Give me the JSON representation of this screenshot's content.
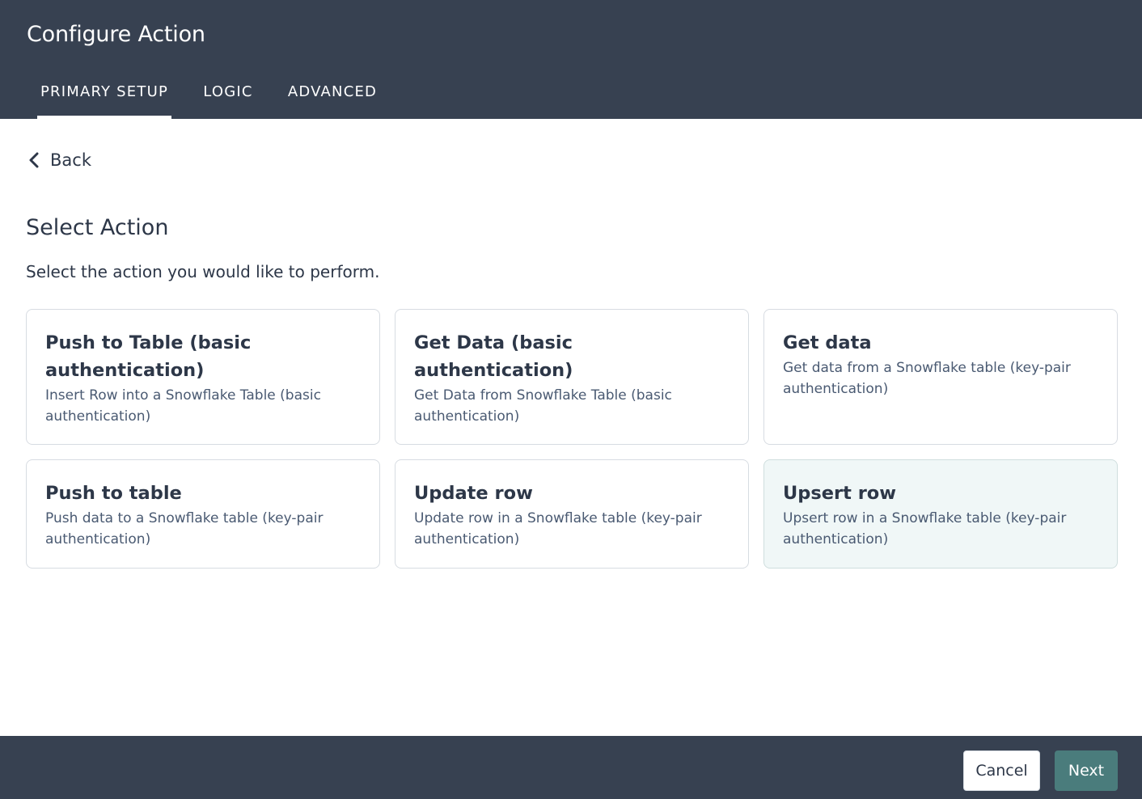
{
  "header": {
    "title": "Configure Action",
    "tabs": [
      {
        "label": "PRIMARY SETUP",
        "active": true
      },
      {
        "label": "LOGIC",
        "active": false
      },
      {
        "label": "ADVANCED",
        "active": false
      }
    ]
  },
  "back": {
    "label": "Back",
    "icon": "chevron-left-icon"
  },
  "section": {
    "title": "Select Action",
    "description": "Select the action you would like to perform."
  },
  "actions": [
    {
      "title": "Push to Table (basic authentication)",
      "description": "Insert Row into a Snowflake Table (basic authentication)",
      "selected": false
    },
    {
      "title": "Get Data (basic authentication)",
      "description": "Get Data from Snowflake Table (basic authentication)",
      "selected": false
    },
    {
      "title": "Get data",
      "description": "Get data from a Snowflake table (key-pair authentication)",
      "selected": false
    },
    {
      "title": "Push to table",
      "description": "Push data to a Snowflake table (key-pair authentication)",
      "selected": false
    },
    {
      "title": "Update row",
      "description": "Update row in a Snowflake table (key-pair authentication)",
      "selected": false
    },
    {
      "title": "Upsert row",
      "description": "Upsert row in a Snowflake table (key-pair authentication)",
      "selected": true
    }
  ],
  "footer": {
    "cancel_label": "Cancel",
    "next_label": "Next"
  },
  "colors": {
    "header_bg": "#374151",
    "accent": "#4a7c7c",
    "selected_card_bg": "#f0f7f7"
  }
}
